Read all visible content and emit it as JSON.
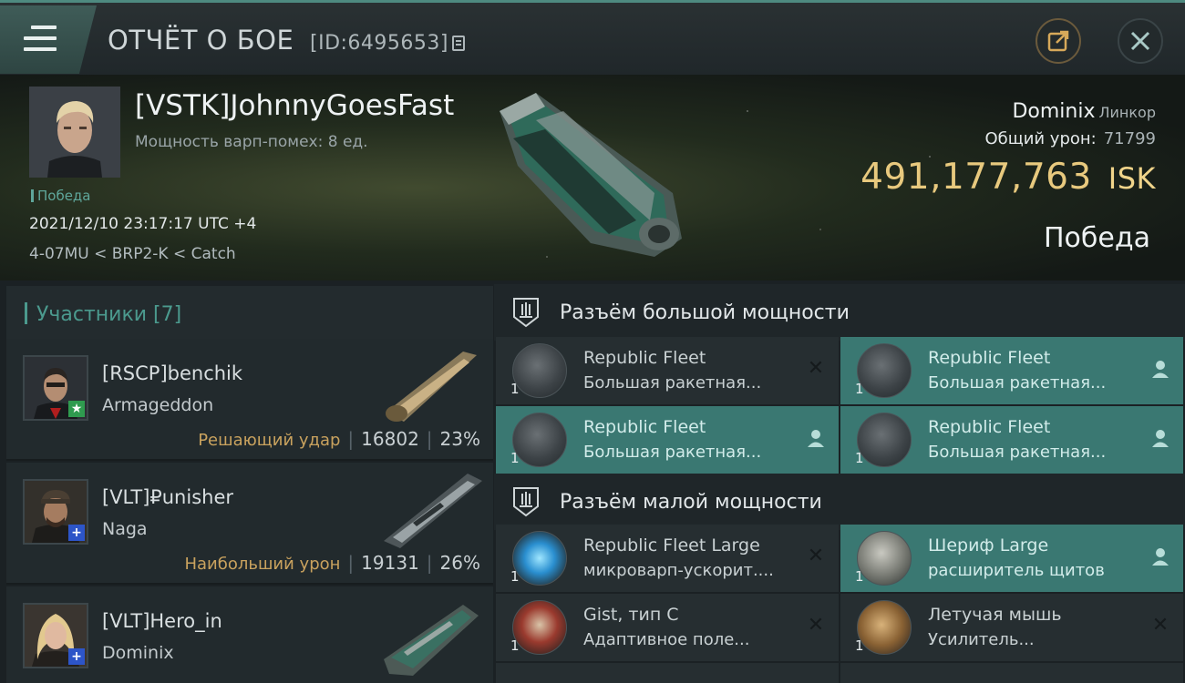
{
  "header": {
    "title": "ОТЧЁТ О БОЕ",
    "report_id": "[ID:6495653]"
  },
  "victim": {
    "name": "[VSTK]JohnnyGoesFast",
    "warp_info": "Мощность варп-помех: 8 ед.",
    "tag": "Победа",
    "datetime": "2021/12/10 23:17:17 UTC +4",
    "location": "4-07MU < BRP2-K < Catch",
    "ship": "Dominix",
    "ship_class": "Линкор",
    "total_damage_label": "Общий урон:",
    "total_damage": "71799",
    "isk_value": "491,177,763",
    "isk_currency": "ISK",
    "result": "Победа"
  },
  "participants": {
    "header": "Участники [7]",
    "rows": [
      {
        "name": "[RSCP]benchik",
        "ship": "Armageddon",
        "role": "Решающий удар",
        "damage": "16802",
        "percent": "23%",
        "badge": "star"
      },
      {
        "name": "[VLT]₽unisher",
        "ship": "Naga",
        "role": "Наибольший урон",
        "damage": "19131",
        "percent": "26%",
        "badge": "plus"
      },
      {
        "name": "[VLT]Hero_in",
        "ship": "Dominix",
        "badge": "plus"
      }
    ]
  },
  "fittings": {
    "high_slot_label": "Разъём большой мощности",
    "low_slot_label": "Разъём малой мощности",
    "modules": [
      {
        "qty": "1",
        "line1": "Republic Fleet",
        "line2": "Большая ракетная...",
        "status": "destroyed"
      },
      {
        "qty": "1",
        "line1": "Republic Fleet",
        "line2": "Большая ракетная...",
        "status": "dropped"
      },
      {
        "qty": "1",
        "line1": "Republic Fleet",
        "line2": "Большая ракетная...",
        "status": "dropped"
      },
      {
        "qty": "1",
        "line1": "Republic Fleet",
        "line2": "Большая ракетная...",
        "status": "dropped"
      },
      {
        "qty": "1",
        "line1": "Republic Fleet Large",
        "line2": "микроварп-ускорит....",
        "status": "destroyed"
      },
      {
        "qty": "1",
        "line1": "Шериф Large",
        "line2": "расширитель щитов",
        "status": "dropped"
      },
      {
        "qty": "1",
        "line1": "Gist, тип C",
        "line2": "Адаптивное поле...",
        "status": "destroyed"
      },
      {
        "qty": "1",
        "line1": "Летучая мышь",
        "line2": "Усилитель...",
        "status": "destroyed"
      }
    ]
  },
  "colors": {
    "accent_teal": "#4b9a8e",
    "isk_gold": "#e8c97e",
    "role_gold": "#c9a25e",
    "active_slot": "#3a7872"
  }
}
